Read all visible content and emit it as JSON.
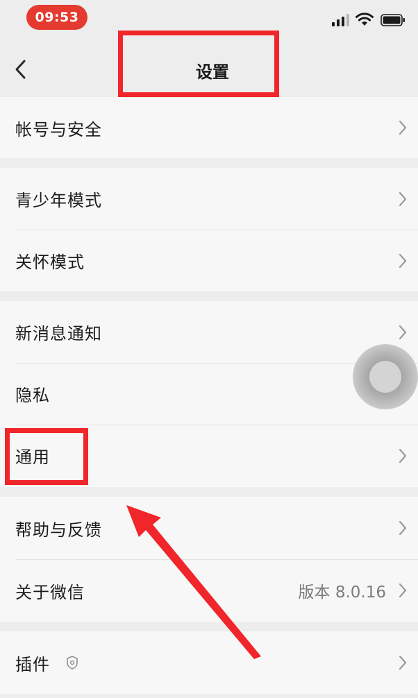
{
  "status_bar": {
    "time": "09:53"
  },
  "nav": {
    "title": "设置",
    "back_icon": "chevron-left-icon"
  },
  "sections": [
    {
      "items": [
        {
          "label": "帐号与安全"
        }
      ]
    },
    {
      "items": [
        {
          "label": "青少年模式"
        },
        {
          "label": "关怀模式"
        }
      ]
    },
    {
      "items": [
        {
          "label": "新消息通知"
        },
        {
          "label": "隐私"
        },
        {
          "label": "通用"
        }
      ]
    },
    {
      "items": [
        {
          "label": "帮助与反馈"
        },
        {
          "label": "关于微信",
          "value": "版本 8.0.16"
        }
      ]
    },
    {
      "items": [
        {
          "label": "插件",
          "icon": "shield-icon"
        }
      ]
    }
  ],
  "colors": {
    "accent_red": "#f0262a",
    "time_pill": "#e43a2f",
    "background": "#ededed",
    "row_background": "#f7f7f7"
  }
}
